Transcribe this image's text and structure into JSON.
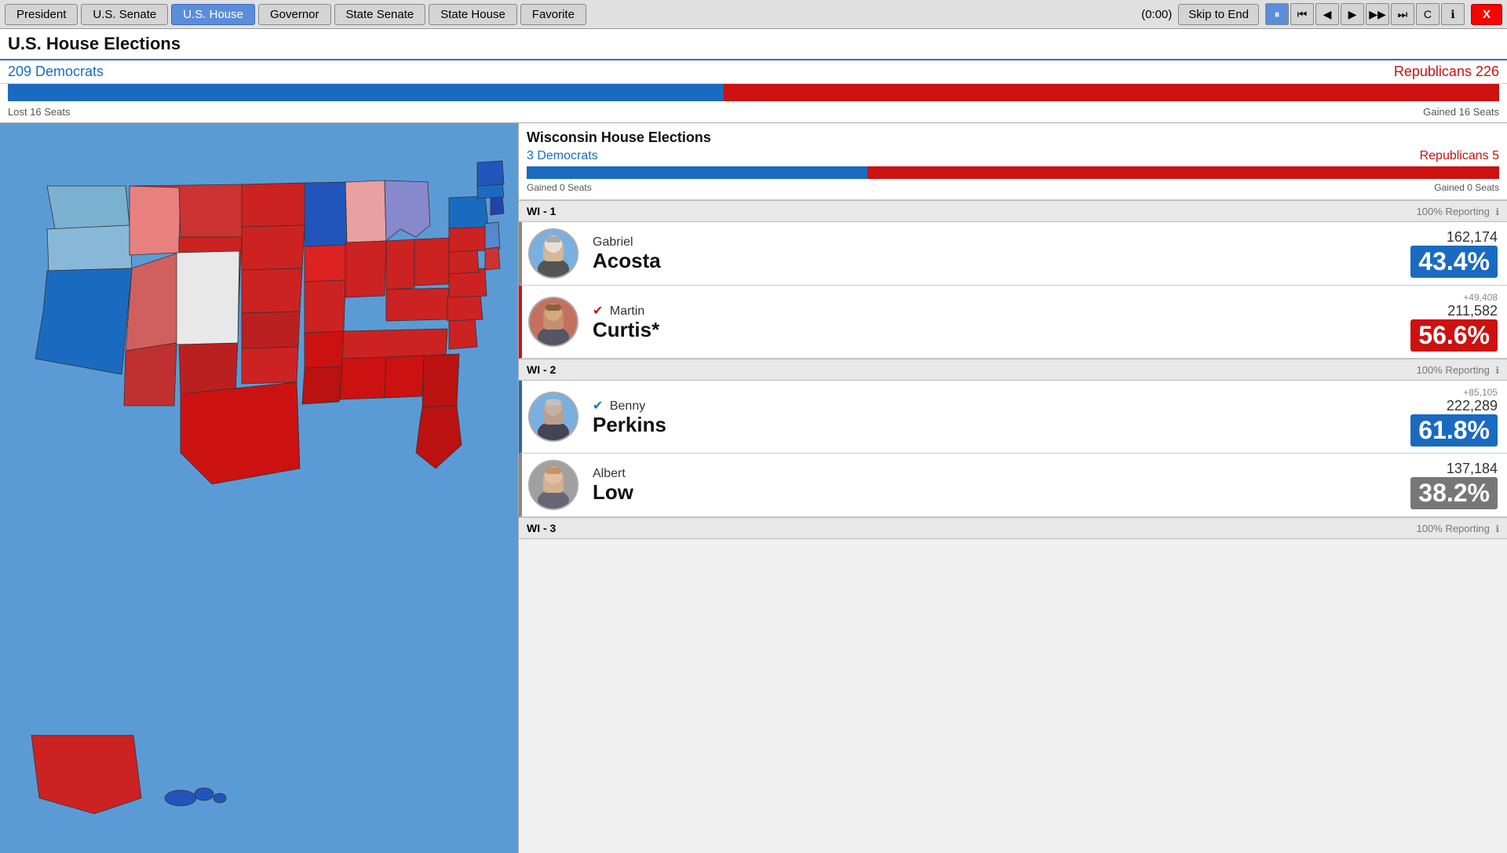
{
  "nav": {
    "tabs": [
      "President",
      "U.S. Senate",
      "U.S. House",
      "Governor",
      "State Senate",
      "State House",
      "Favorite"
    ],
    "active_tab": "U.S. House",
    "timer": "(0:00)",
    "skip_label": "Skip to End",
    "close_label": "X"
  },
  "header": {
    "title": "U.S. House Elections"
  },
  "national": {
    "dem_label": "209 Democrats",
    "rep_label": "Republicans 226",
    "dem_pct": 48,
    "rep_pct": 52,
    "lost_seats": "Lost 16 Seats",
    "gained_seats": "Gained 16 Seats"
  },
  "wisconsin": {
    "title": "Wisconsin House Elections",
    "dem_label": "3 Democrats",
    "rep_label": "Republicans 5",
    "dem_pct": 35,
    "rep_pct": 65,
    "gained_dem": "Gained 0 Seats",
    "gained_rep": "Gained 0 Seats"
  },
  "districts": [
    {
      "id": "WI - 1",
      "reporting": "100% Reporting",
      "candidates": [
        {
          "first": "Gabriel",
          "last": "Acosta",
          "party": "dem",
          "winner": false,
          "check": false,
          "votes": "162,174",
          "pct": "43.4%",
          "margin": ""
        },
        {
          "first": "Martin",
          "last": "Curtis*",
          "party": "rep",
          "winner": true,
          "check": true,
          "votes": "211,582",
          "pct": "56.6%",
          "margin": "+49,408"
        }
      ]
    },
    {
      "id": "WI - 2",
      "reporting": "100% Reporting",
      "candidates": [
        {
          "first": "Benny",
          "last": "Perkins",
          "party": "dem",
          "winner": true,
          "check": true,
          "votes": "222,289",
          "pct": "61.8%",
          "margin": "+85,105"
        },
        {
          "first": "Albert",
          "last": "Low",
          "party": "ind",
          "winner": false,
          "check": false,
          "votes": "137,184",
          "pct": "38.2%",
          "margin": ""
        }
      ]
    },
    {
      "id": "WI - 3",
      "reporting": "100% Reporting",
      "candidates": []
    }
  ],
  "controls": {
    "pause": "⏸",
    "step_back": "⏮",
    "prev": "◀",
    "play": "▶",
    "next": "▶▶",
    "fast": "⏭",
    "reset": "C",
    "info": "ℹ"
  }
}
